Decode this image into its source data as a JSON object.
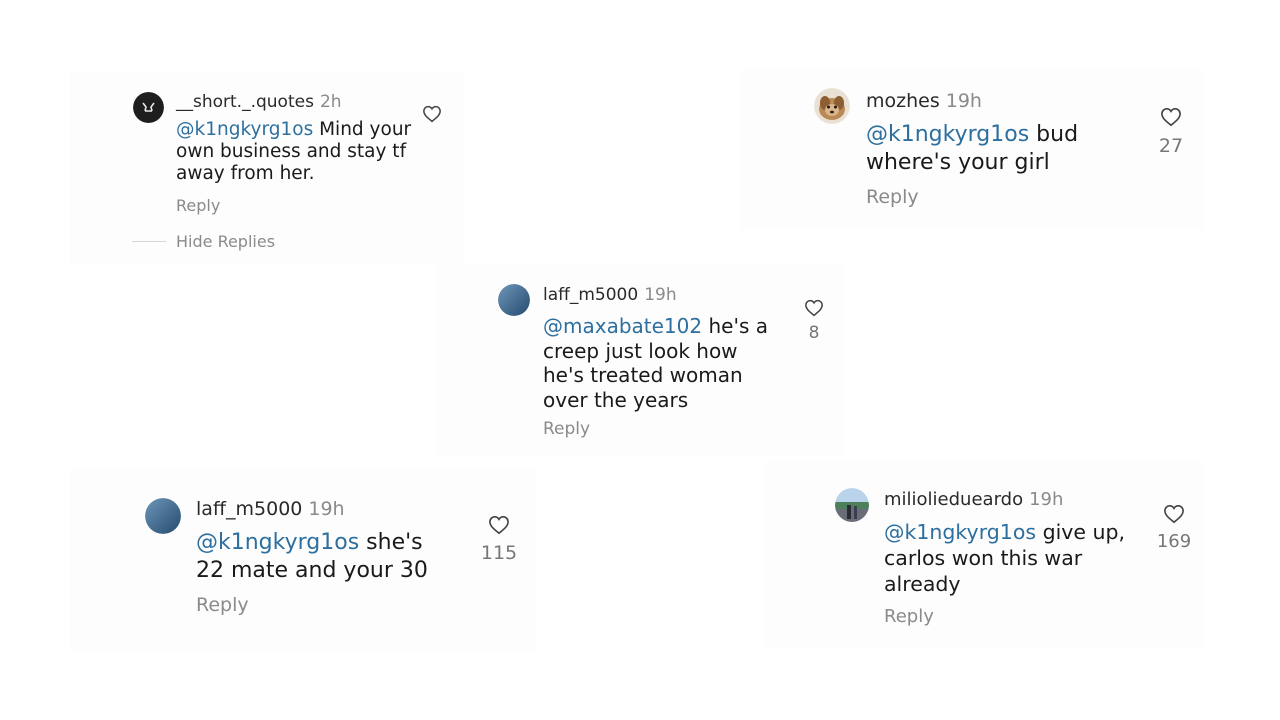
{
  "comments": [
    {
      "username": "__short._.quotes",
      "time": "2h",
      "mention": "@k1ngkyrg1os",
      "text": " Mind your own business and stay tf away from her.",
      "reply": "Reply",
      "likes": "",
      "hide_replies": "Hide Replies",
      "avatar": "black-badge-avatar"
    },
    {
      "username": "mozhes",
      "time": "19h",
      "mention": "@k1ngkyrg1os",
      "text": " bud where's your girl",
      "reply": "Reply",
      "likes": "27",
      "avatar": "dog-photo-avatar"
    },
    {
      "username": "laff_m5000",
      "time": "19h",
      "mention": "@maxabate102",
      "text": " he's a creep just look how he's treated woman over the years",
      "reply": "Reply",
      "likes": "8",
      "avatar": "blue-gradient-avatar"
    },
    {
      "username": "laff_m5000",
      "time": "19h",
      "mention": "@k1ngkyrg1os",
      "text": " she's 22 mate and your 30",
      "reply": "Reply",
      "likes": "115",
      "avatar": "blue-gradient-avatar"
    },
    {
      "username": "milioliedueardo",
      "time": "19h",
      "mention": "@k1ngkyrg1os",
      "text": " give up, carlos won this war already",
      "reply": "Reply",
      "likes": "169",
      "avatar": "scenery-photo-avatar"
    }
  ],
  "colors": {
    "mention": "#2d6f9e",
    "muted": "#8a8a8a",
    "text": "#1a1a1a"
  }
}
